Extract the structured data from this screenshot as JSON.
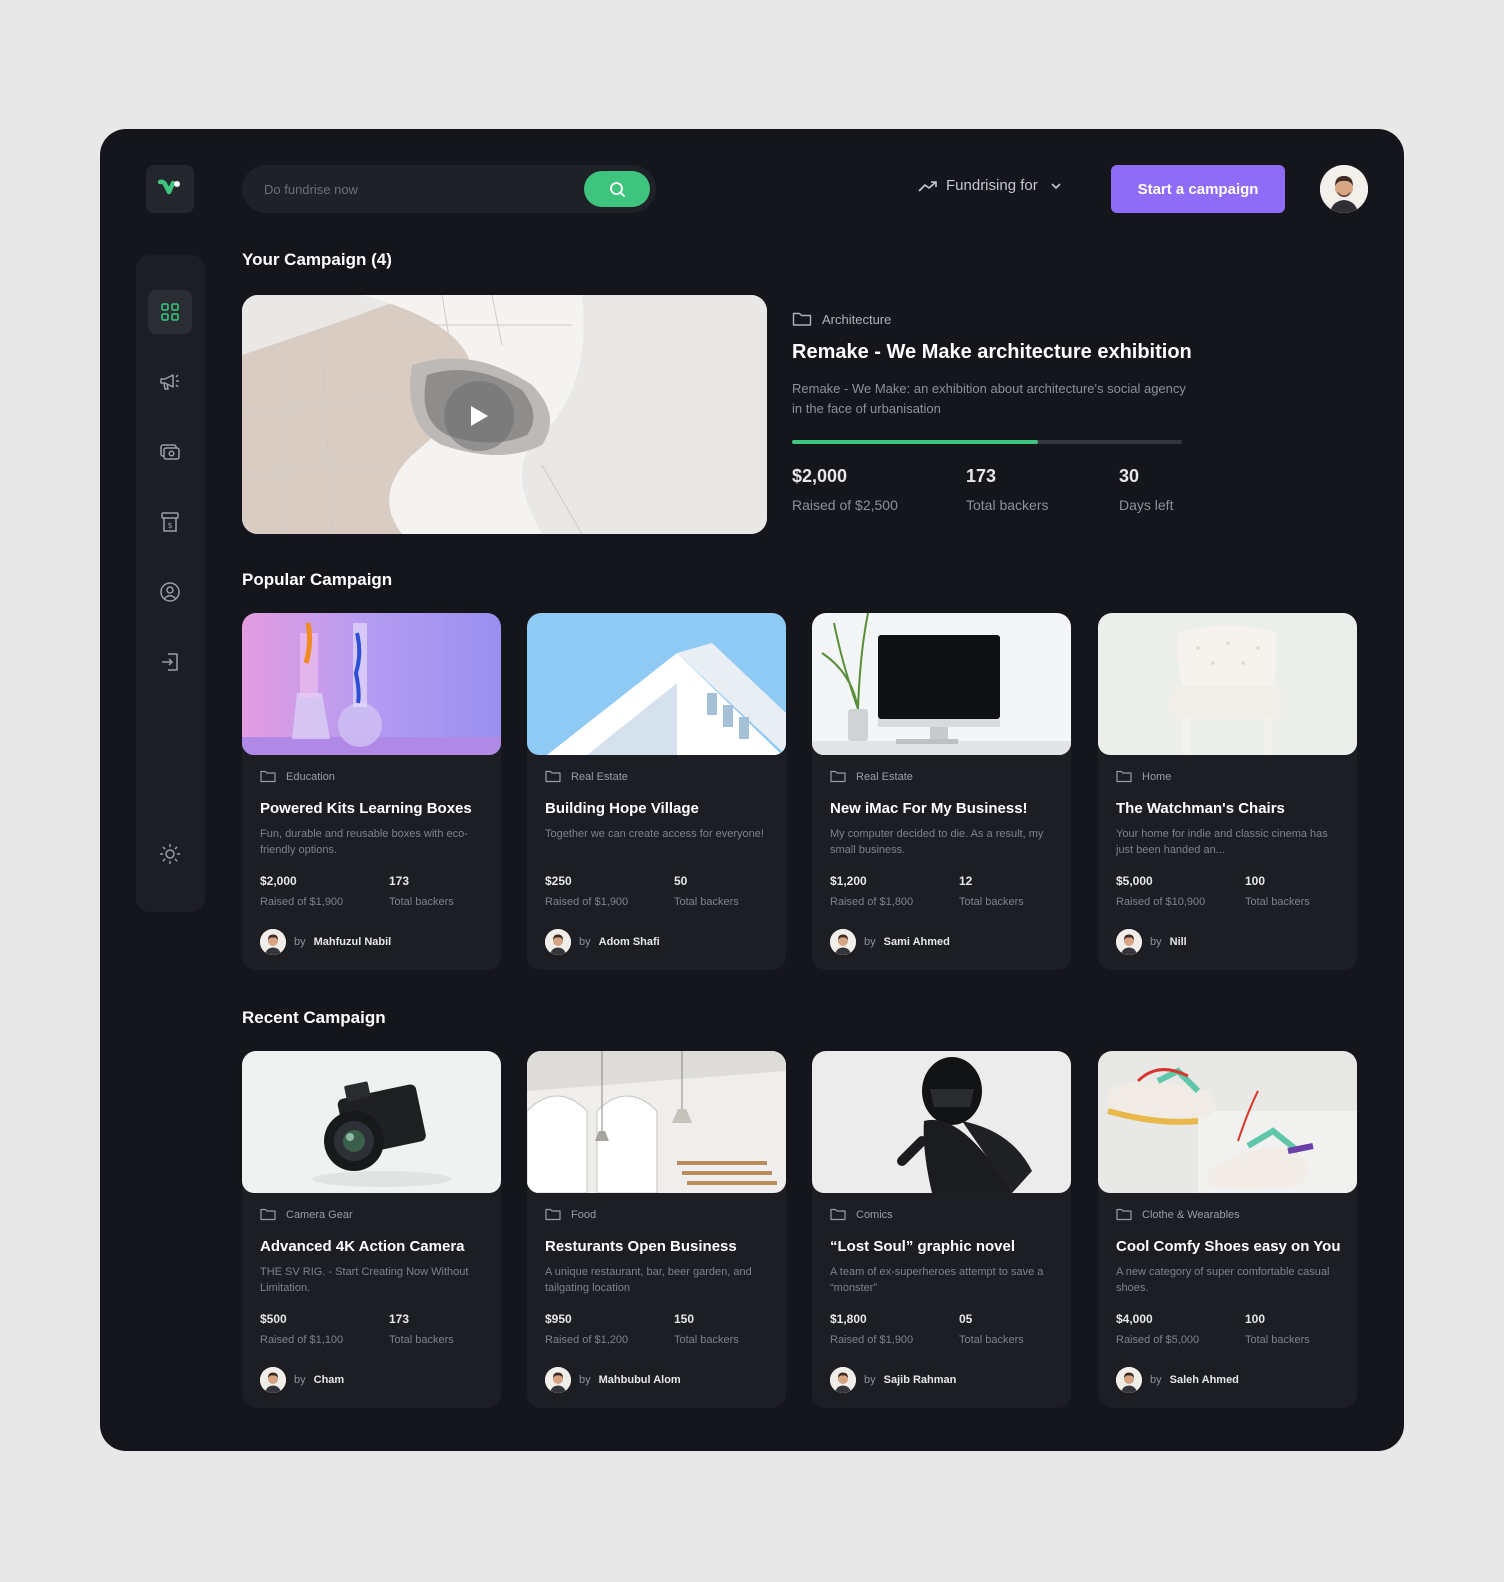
{
  "colors": {
    "accent_green": "#3ec47d",
    "accent_purple": "#8f6cf7",
    "panel_bg": "#15161c",
    "card_bg": "#1c1e24"
  },
  "header": {
    "search_placeholder": "Do fundrise now",
    "fundrising_label": "Fundrising for",
    "start_button": "Start a campaign"
  },
  "sidebar": {
    "items": [
      {
        "icon": "grid-icon",
        "active": true
      },
      {
        "icon": "megaphone-icon",
        "active": false
      },
      {
        "icon": "money-icon",
        "active": false
      },
      {
        "icon": "receipt-icon",
        "active": false
      },
      {
        "icon": "user-circle-icon",
        "active": false
      },
      {
        "icon": "login-icon",
        "active": false
      },
      {
        "icon": "sun-icon",
        "active": false
      }
    ]
  },
  "your_campaign": {
    "title": "Your Campaign (4)",
    "category": "Architecture",
    "name": "Remake - We Make architecture exhibition",
    "description": "Remake - We Make: an exhibition about architecture's social agency in the face of urbanisation",
    "progress": 0.63,
    "raised": "$2,000",
    "raised_of": "Raised of $2,500",
    "backers": "173",
    "backers_label": "Total backers",
    "days": "30",
    "days_label": "Days left"
  },
  "popular": {
    "title": "Popular Campaign",
    "cards": [
      {
        "category": "Education",
        "title": "Powered Kits Learning Boxes",
        "desc": "Fun, durable and reusable boxes with eco-friendly options.",
        "raised": "$2,000",
        "raised_of": "Raised of $1,900",
        "backers": "173",
        "backers_label": "Total backers",
        "by": "by",
        "author": "Mahfuzul Nabil"
      },
      {
        "category": "Real Estate",
        "title": "Building Hope Village",
        "desc": "Together we can create access for everyone!",
        "raised": "$250",
        "raised_of": "Raised of $1,900",
        "backers": "50",
        "backers_label": "Total backers",
        "by": "by",
        "author": "Adom Shafi"
      },
      {
        "category": "Real Estate",
        "title": "New iMac For My Business!",
        "desc": "My computer decided to die. As a result, my small business.",
        "raised": "$1,200",
        "raised_of": "Raised of $1,800",
        "backers": "12",
        "backers_label": "Total backers",
        "by": "by",
        "author": "Sami Ahmed"
      },
      {
        "category": "Home",
        "title": "The Watchman's Chairs",
        "desc": "Your home for indie and classic cinema has just been handed an...",
        "raised": "$5,000",
        "raised_of": "Raised of $10,900",
        "backers": "100",
        "backers_label": "Total backers",
        "by": "by",
        "author": "Nill"
      }
    ]
  },
  "recent": {
    "title": "Recent Campaign",
    "cards": [
      {
        "category": "Camera Gear",
        "title": "Advanced 4K Action Camera",
        "desc": "THE SV RIG. - Start Creating Now Without Limitation.",
        "raised": "$500",
        "raised_of": "Raised of $1,100",
        "backers": "173",
        "backers_label": "Total backers",
        "by": "by",
        "author": "Cham"
      },
      {
        "category": "Food",
        "title": "Resturants Open Business",
        "desc": "A unique restaurant, bar, beer garden, and tailgating location",
        "raised": "$950",
        "raised_of": "Raised of $1,200",
        "backers": "150",
        "backers_label": "Total backers",
        "by": "by",
        "author": "Mahbubul Alom"
      },
      {
        "category": "Comics",
        "title": "“Lost Soul” graphic novel",
        "desc": "A team of ex-superheroes attempt to save a “monster”",
        "raised": "$1,800",
        "raised_of": "Raised of $1,900",
        "backers": "05",
        "backers_label": "Total backers",
        "by": "by",
        "author": "Sajib Rahman"
      },
      {
        "category": "Clothe & Wearables",
        "title": "Cool Comfy Shoes easy on You",
        "desc": "A new category of super comfortable casual shoes.",
        "raised": "$4,000",
        "raised_of": "Raised of $5,000",
        "backers": "100",
        "backers_label": "Total backers",
        "by": "by",
        "author": "Saleh Ahmed"
      }
    ]
  }
}
